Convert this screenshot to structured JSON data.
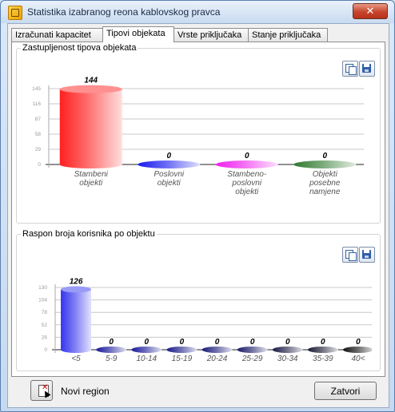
{
  "window": {
    "title": "Statistika izabranog reona kablovskog pravca",
    "close_glyph": "✕"
  },
  "tabs": [
    {
      "label": "Izračunati kapacitet",
      "active": false
    },
    {
      "label": "Tipovi objekata",
      "active": true
    },
    {
      "label": "Vrste priključaka",
      "active": false
    },
    {
      "label": "Stanje priključaka",
      "active": false
    }
  ],
  "group1": {
    "legend": "Zastupljenost tipova objekata",
    "copy_icon": "copy-icon",
    "save_icon": "save-icon"
  },
  "group2": {
    "legend": "Raspon broja korisnika po objektu",
    "copy_icon": "copy-icon",
    "save_icon": "save-icon"
  },
  "footer": {
    "new_region_label": "Novi region",
    "close_label": "Zatvori"
  },
  "chart_data": [
    {
      "type": "bar",
      "title": "",
      "categories": [
        [
          "Stambeni",
          "objekti"
        ],
        [
          "Poslovni",
          "objekti"
        ],
        [
          "Stambeno-",
          "poslovni",
          "objekti"
        ],
        [
          "Objekti",
          "posebne",
          "namjene"
        ]
      ],
      "values": [
        144,
        0,
        0,
        0
      ],
      "colors": [
        "#ff2020",
        "#1a1aee",
        "#ee20ee",
        "#2f7a2f"
      ],
      "ytick_labels": [
        "0",
        "29",
        "58",
        "87",
        "116",
        "145"
      ],
      "ylim": [
        0,
        145
      ],
      "grid": true,
      "legend": "none"
    },
    {
      "type": "bar",
      "title": "",
      "categories": [
        "<5",
        "5-9",
        "10-14",
        "15-19",
        "20-24",
        "25-29",
        "30-34",
        "35-39",
        "40<"
      ],
      "values": [
        126,
        0,
        0,
        0,
        0,
        0,
        0,
        0,
        0
      ],
      "colors": [
        "#3535ee",
        "#1a1a99",
        "#1a1a99",
        "#1a1a88",
        "#1a1a77",
        "#1a1a66",
        "#1a1a44",
        "#1a1a33",
        "#111111"
      ],
      "ytick_labels": [
        "0",
        "26",
        "52",
        "78",
        "104",
        "130"
      ],
      "ylim": [
        0,
        130
      ],
      "grid": true,
      "legend": "none"
    }
  ]
}
